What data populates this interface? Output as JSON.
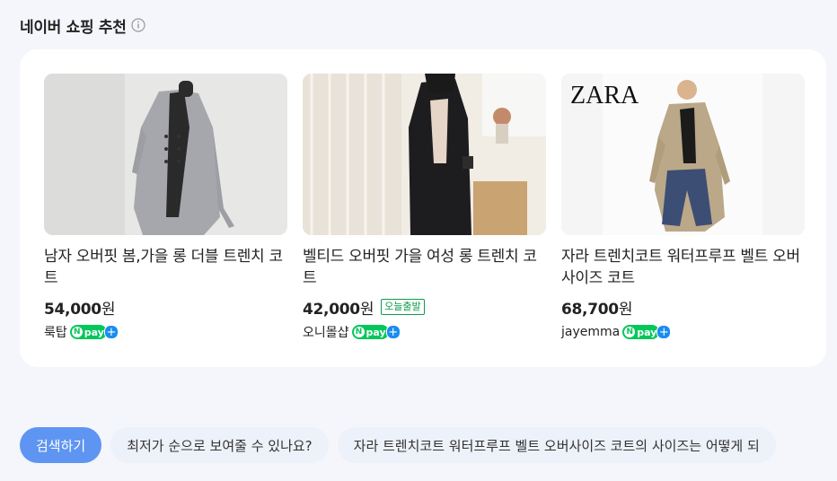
{
  "section_title": "네이버 쇼핑 추천",
  "products": [
    {
      "name": "남자 오버핏 봄,가을 롱 더블 트렌치 코트",
      "price": "54,000",
      "currency": "원",
      "badge": "",
      "seller": "룩탑",
      "pay": "pay"
    },
    {
      "name": "벨티드 오버핏 가을 여성 롱 트렌치 코트",
      "price": "42,000",
      "currency": "원",
      "badge": "오늘출발",
      "seller": "오니몰샵",
      "pay": "pay"
    },
    {
      "name": "자라 트렌치코트 워터프루프 벨트 오버사이즈 코트",
      "price": "68,700",
      "currency": "원",
      "badge": "",
      "seller": "jayemma",
      "pay": "pay"
    }
  ],
  "brand_logo_text": "ZARA",
  "bottom": {
    "search_button": "검색하기",
    "chips": [
      "최저가 순으로 보여줄 수 있나요?",
      "자라 트렌치코트 워터프루프 벨트 오버사이즈 코트의 사이즈는 어떻게 되"
    ]
  },
  "colors": {
    "accent": "#5f95f2",
    "npay_green": "#03c75a",
    "badge_green": "#0d9b4d"
  }
}
